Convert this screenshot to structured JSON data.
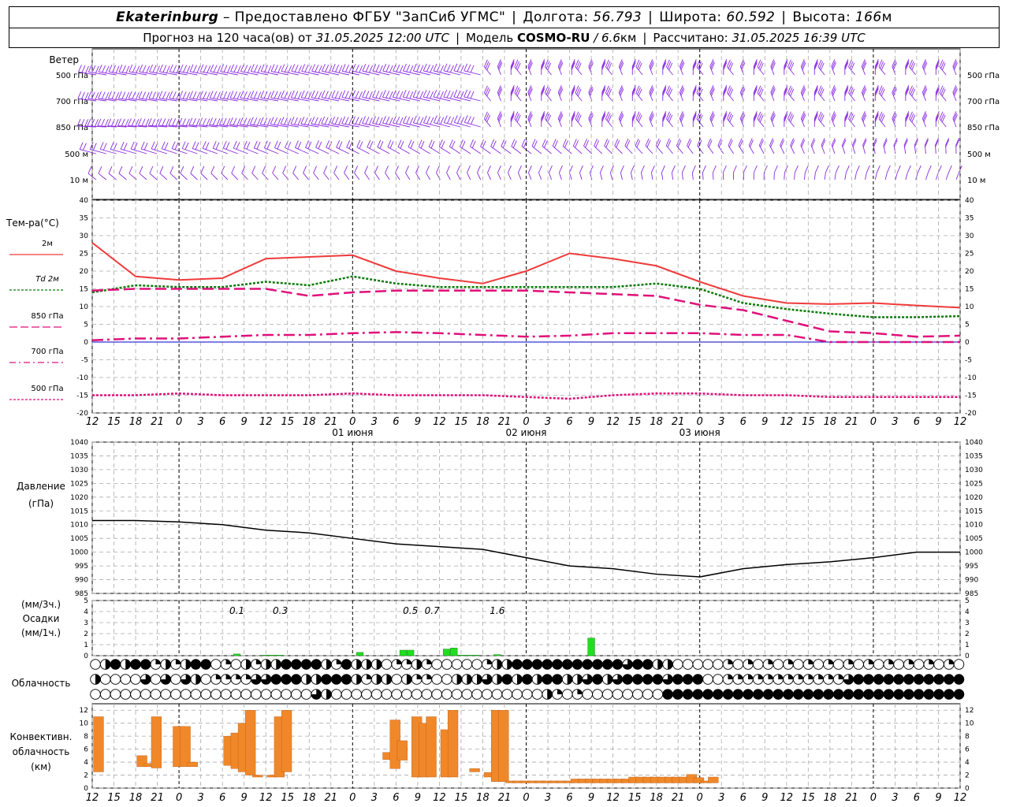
{
  "header": {
    "station": "Ekaterinburg",
    "provider": "– Предоставлено ФГБУ \"ЗапСиб УГМС\"",
    "lon_label": "Долгота:",
    "lon": "56.793",
    "lat_label": "Широта:",
    "lat": "60.592",
    "alt_label": "Высота:",
    "alt": "166",
    "alt_unit": "м",
    "forecast_label": "Прогноз на 120 часа(ов) от",
    "forecast_time": "31.05.2025 12:00 UTC",
    "model_label": "Модель",
    "model": "COSMO-RU",
    "resolution": "/ 6.6",
    "resolution_unit": "км",
    "computed_label": "Рассчитано:",
    "computed_time": "31.05.2025 16:39 UTC"
  },
  "labels": {
    "wind": "Ветер",
    "temp": "Тем-ра(°С)",
    "pressure_1": "Давление",
    "pressure_2": "(гПа)",
    "precip_1": "(мм/3ч.)",
    "precip_2": "Осадки",
    "precip_3": "(мм/1ч.)",
    "cloud": "Облачность",
    "conv_1": "Конвективн.",
    "conv_2": "облачность",
    "conv_3": "(км)"
  },
  "colors": {
    "wind": "#8a2be2",
    "t2m": "#ef3a3a",
    "td2m": "#0a7a0a",
    "t850": "#e0107a",
    "t700": "#e0107a",
    "t500": "#e0107a",
    "zero_line": "#0000cc",
    "precip": "#22dd22",
    "conv": "#f0882a"
  },
  "chart_data": [
    {
      "type": "wind_barbs",
      "levels": [
        "500 гПа",
        "700 гПа",
        "850 гПа",
        "500 м",
        "10  м"
      ],
      "title": "Ветер"
    },
    {
      "type": "line",
      "title": "Тем-ра(°С)",
      "ylim": [
        -20,
        40
      ],
      "yticks": [
        40,
        35,
        30,
        25,
        20,
        15,
        10,
        5,
        0,
        -5,
        -10,
        -15,
        -20
      ],
      "x_hours": [
        0,
        6,
        12,
        18,
        24,
        30,
        36,
        42,
        48,
        54,
        60,
        66,
        72,
        78,
        84,
        90,
        96,
        102,
        108,
        114,
        120
      ],
      "series": [
        {
          "name": "2м",
          "values": [
            28,
            18.5,
            17.5,
            18,
            23.5,
            24,
            24.5,
            20,
            18,
            16.5,
            20,
            25,
            23.5,
            21.5,
            17,
            13,
            11,
            10.7,
            11,
            10.3,
            9.7
          ]
        },
        {
          "name": "Td  2м",
          "values": [
            14,
            16,
            15.5,
            15.5,
            17,
            16,
            18.5,
            16.5,
            15.5,
            15.5,
            15.5,
            15.5,
            15.5,
            16.5,
            15,
            11,
            9.3,
            8,
            7,
            7,
            7.3
          ]
        },
        {
          "name": "850  гПа",
          "values": [
            14.5,
            15,
            15,
            15,
            15,
            13,
            14,
            14.5,
            14.5,
            14.5,
            14.5,
            14,
            13.5,
            13,
            10.5,
            9,
            6,
            3,
            2.5,
            1.5,
            1.8
          ]
        },
        {
          "name": "700  гПа",
          "values": [
            0.5,
            1,
            1,
            1.5,
            2,
            2,
            2.5,
            2.8,
            2.5,
            2,
            1.5,
            1.8,
            2.5,
            2.5,
            2.5,
            2,
            2,
            0,
            0,
            0,
            0
          ]
        },
        {
          "name": "500  гПа",
          "values": [
            -15,
            -15,
            -14.5,
            -15,
            -15,
            -15,
            -14.5,
            -15,
            -15,
            -15,
            -15.5,
            -16,
            -15,
            -14.5,
            -14.5,
            -15,
            -15,
            -15.5,
            -15.5,
            -15.5,
            -15.5
          ]
        }
      ]
    },
    {
      "type": "line",
      "title": "Давление (гПа)",
      "ylim": [
        985,
        1040
      ],
      "yticks": [
        1040,
        1035,
        1030,
        1025,
        1020,
        1015,
        1010,
        1005,
        1000,
        995,
        990,
        985
      ],
      "x_hours": [
        0,
        6,
        12,
        18,
        24,
        30,
        36,
        42,
        48,
        54,
        60,
        66,
        72,
        78,
        84,
        90,
        96,
        102,
        108,
        114,
        120
      ],
      "series": [
        {
          "name": "Давление",
          "values": [
            1011.5,
            1011.5,
            1011,
            1010,
            1008,
            1007,
            1005,
            1003,
            1002,
            1001,
            998,
            995,
            994,
            992,
            991,
            994,
            995.5,
            996.5,
            998,
            1000,
            1000
          ]
        }
      ]
    },
    {
      "type": "bar",
      "title": "Осадки (мм/1ч.)",
      "ylim": [
        0,
        5
      ],
      "yticks": [
        5,
        4,
        3,
        2,
        1,
        0
      ],
      "x_hours": [
        20,
        24,
        25,
        26,
        37,
        43,
        44,
        49,
        50,
        51,
        52,
        53,
        56,
        69
      ],
      "values": [
        0.15,
        0.05,
        0.05,
        0.05,
        0.3,
        0.5,
        0.5,
        0.6,
        0.7,
        0.05,
        0.05,
        0.05,
        0.1,
        1.6
      ],
      "annotations": [
        {
          "x_hour": 20,
          "text": "0.1"
        },
        {
          "x_hour": 26,
          "text": "0.3"
        },
        {
          "x_hour": 44,
          "text": "0.5"
        },
        {
          "x_hour": 47,
          "text": "0.7"
        },
        {
          "x_hour": 56,
          "text": "1.6"
        }
      ]
    },
    {
      "type": "table",
      "title": "Облачность",
      "rows": [
        [
          0,
          2,
          4,
          2,
          4,
          4,
          1,
          2,
          1,
          2,
          4,
          4,
          0,
          1,
          0,
          2,
          1,
          2,
          2,
          4,
          4,
          4,
          4,
          2,
          1,
          4,
          2,
          2,
          2,
          0,
          1,
          1,
          2,
          1,
          0,
          0,
          0,
          0,
          0,
          1,
          2,
          2,
          4,
          4,
          4,
          4,
          4,
          4,
          4,
          4,
          4,
          4,
          4,
          3,
          4,
          4,
          2,
          2,
          0,
          0,
          0,
          0,
          0,
          1,
          0,
          1,
          0,
          1,
          0,
          1,
          0,
          1,
          0,
          1,
          0,
          1,
          0,
          1,
          0,
          1,
          0,
          1,
          0,
          1,
          0,
          1,
          0
        ],
        [
          2,
          0,
          0,
          0,
          0,
          3,
          0,
          3,
          0,
          3,
          2,
          0,
          1,
          1,
          1,
          1,
          3,
          3,
          4,
          4,
          4,
          2,
          2,
          4,
          4,
          4,
          2,
          1,
          2,
          2,
          0,
          2,
          1,
          1,
          0,
          0,
          2,
          2,
          2,
          3,
          2,
          4,
          2,
          4,
          2,
          4,
          4,
          2,
          2,
          3,
          4,
          2,
          3,
          4,
          4,
          4,
          4,
          3,
          4,
          4,
          4,
          0,
          0,
          1,
          1,
          1,
          1,
          1,
          1,
          1,
          1,
          1,
          1,
          1,
          1,
          3,
          4,
          4,
          4,
          4,
          4,
          4,
          4,
          4,
          4,
          4,
          4
        ],
        [
          0,
          0,
          0,
          0,
          0,
          0,
          0,
          0,
          0,
          0,
          0,
          0,
          0,
          0,
          0,
          0,
          0,
          0,
          0,
          0,
          0,
          0,
          3,
          2,
          0,
          0,
          0,
          0,
          0,
          0,
          0,
          0,
          0,
          0,
          0,
          0,
          0,
          0,
          0,
          0,
          0,
          0,
          0,
          0,
          0,
          2,
          1,
          0,
          1,
          0,
          0,
          0,
          0,
          0,
          0,
          0,
          0,
          4,
          4,
          4,
          4,
          4,
          4,
          4,
          4,
          4,
          4,
          4,
          4,
          4,
          4,
          4,
          4,
          4,
          4,
          4,
          4,
          4,
          4,
          4,
          4,
          4,
          4,
          4,
          4,
          4,
          4
        ]
      ]
    },
    {
      "type": "bar",
      "title": "Конвективн. облачность (км)",
      "ylim": [
        0,
        13
      ],
      "yticks": [
        12,
        10,
        8,
        6,
        4,
        2,
        0
      ],
      "bars": [
        {
          "x_hour": 0,
          "bottom": 2.5,
          "top": 11
        },
        {
          "x_hour": 6,
          "bottom": 3.3,
          "top": 5
        },
        {
          "x_hour": 7,
          "bottom": 3.3,
          "top": 3.8
        },
        {
          "x_hour": 8,
          "bottom": 3.1,
          "top": 11
        },
        {
          "x_hour": 11,
          "bottom": 3.3,
          "top": 9.5
        },
        {
          "x_hour": 12,
          "bottom": 3.3,
          "top": 9.5
        },
        {
          "x_hour": 13,
          "bottom": 3.3,
          "top": 4
        },
        {
          "x_hour": 18,
          "bottom": 3.5,
          "top": 8
        },
        {
          "x_hour": 19,
          "bottom": 3,
          "top": 8.5
        },
        {
          "x_hour": 20,
          "bottom": 2.5,
          "top": 10
        },
        {
          "x_hour": 21,
          "bottom": 2,
          "top": 12
        },
        {
          "x_hour": 22,
          "bottom": 1.7,
          "top": 2
        },
        {
          "x_hour": 24,
          "bottom": 1.7,
          "top": 2
        },
        {
          "x_hour": 25,
          "bottom": 1.7,
          "top": 11
        },
        {
          "x_hour": 26,
          "bottom": 2.5,
          "top": 12
        },
        {
          "x_hour": 40,
          "bottom": 4.4,
          "top": 5.5
        },
        {
          "x_hour": 41,
          "bottom": 3,
          "top": 10.5
        },
        {
          "x_hour": 42,
          "bottom": 4.3,
          "top": 7.3
        },
        {
          "x_hour": 44,
          "bottom": 1.7,
          "top": 11
        },
        {
          "x_hour": 45,
          "bottom": 1.7,
          "top": 10
        },
        {
          "x_hour": 46,
          "bottom": 1.7,
          "top": 11
        },
        {
          "x_hour": 48,
          "bottom": 1.7,
          "top": 9
        },
        {
          "x_hour": 49,
          "bottom": 1.7,
          "top": 12
        },
        {
          "x_hour": 52,
          "bottom": 2.5,
          "top": 3
        },
        {
          "x_hour": 54,
          "bottom": 1.7,
          "top": 2.4
        },
        {
          "x_hour": 55,
          "bottom": 1,
          "top": 12
        },
        {
          "x_hour": 56,
          "bottom": 1,
          "top": 12
        },
        {
          "x_hour": 57,
          "bottom": 0.8,
          "top": 1.1
        },
        {
          "x_hour": 58,
          "bottom": 0.8,
          "top": 1.1
        },
        {
          "x_hour": 59,
          "bottom": 0.8,
          "top": 1.1
        },
        {
          "x_hour": 60,
          "bottom": 0.8,
          "top": 1.1
        },
        {
          "x_hour": 61,
          "bottom": 0.8,
          "top": 1.1
        },
        {
          "x_hour": 62,
          "bottom": 0.8,
          "top": 1.1
        },
        {
          "x_hour": 63,
          "bottom": 0.8,
          "top": 1.1
        },
        {
          "x_hour": 64,
          "bottom": 0.8,
          "top": 1.1
        },
        {
          "x_hour": 65,
          "bottom": 0.8,
          "top": 1.1
        },
        {
          "x_hour": 66,
          "bottom": 0.8,
          "top": 1.4
        },
        {
          "x_hour": 67,
          "bottom": 0.8,
          "top": 1.4
        },
        {
          "x_hour": 68,
          "bottom": 0.8,
          "top": 1.4
        },
        {
          "x_hour": 69,
          "bottom": 0.8,
          "top": 1.4
        },
        {
          "x_hour": 70,
          "bottom": 0.8,
          "top": 1.4
        },
        {
          "x_hour": 71,
          "bottom": 0.8,
          "top": 1.4
        },
        {
          "x_hour": 72,
          "bottom": 0.8,
          "top": 1.4
        },
        {
          "x_hour": 73,
          "bottom": 0.8,
          "top": 1.4
        },
        {
          "x_hour": 74,
          "bottom": 0.8,
          "top": 1.7
        },
        {
          "x_hour": 75,
          "bottom": 0.8,
          "top": 1.7
        },
        {
          "x_hour": 76,
          "bottom": 0.8,
          "top": 1.7
        },
        {
          "x_hour": 77,
          "bottom": 0.8,
          "top": 1.7
        },
        {
          "x_hour": 78,
          "bottom": 0.8,
          "top": 1.7
        },
        {
          "x_hour": 79,
          "bottom": 0.8,
          "top": 1.7
        },
        {
          "x_hour": 80,
          "bottom": 0.8,
          "top": 1.7
        },
        {
          "x_hour": 81,
          "bottom": 0.8,
          "top": 1.7
        },
        {
          "x_hour": 82,
          "bottom": 0.8,
          "top": 2.1
        },
        {
          "x_hour": 83,
          "bottom": 0.8,
          "top": 1.6
        },
        {
          "x_hour": 84,
          "bottom": 0.8,
          "top": 1.1
        },
        {
          "x_hour": 85,
          "bottom": 0.8,
          "top": 1.7
        }
      ]
    },
    {
      "type": "axis",
      "x_hour_ticks": [
        0,
        3,
        6,
        9,
        12,
        15,
        18,
        21,
        24,
        27,
        30,
        33,
        36,
        39,
        42,
        45,
        48,
        51,
        54,
        57,
        60,
        63,
        66,
        69,
        72,
        75,
        78,
        81,
        84,
        87,
        90,
        93,
        96,
        99,
        102,
        105,
        108,
        111,
        114,
        117,
        120
      ],
      "x_tick_labels": [
        "12",
        "15",
        "18",
        "21",
        "0",
        "3",
        "6",
        "9",
        "12",
        "15",
        "18",
        "21",
        "0",
        "3",
        "6",
        "9",
        "12",
        "15",
        "18",
        "21",
        "0",
        "3",
        "6",
        "9",
        "12",
        "15",
        "18",
        "21",
        "0",
        "3",
        "6",
        "9",
        "12",
        "15",
        "18",
        "21",
        "0",
        "3",
        "6",
        "9",
        "12",
        "15",
        "18"
      ],
      "day_labels": [
        {
          "x_hour": 24,
          "text": "01 июня"
        },
        {
          "x_hour": 48,
          "text": "02 июня"
        },
        {
          "x_hour": 72,
          "text": "03 июня"
        }
      ]
    }
  ]
}
